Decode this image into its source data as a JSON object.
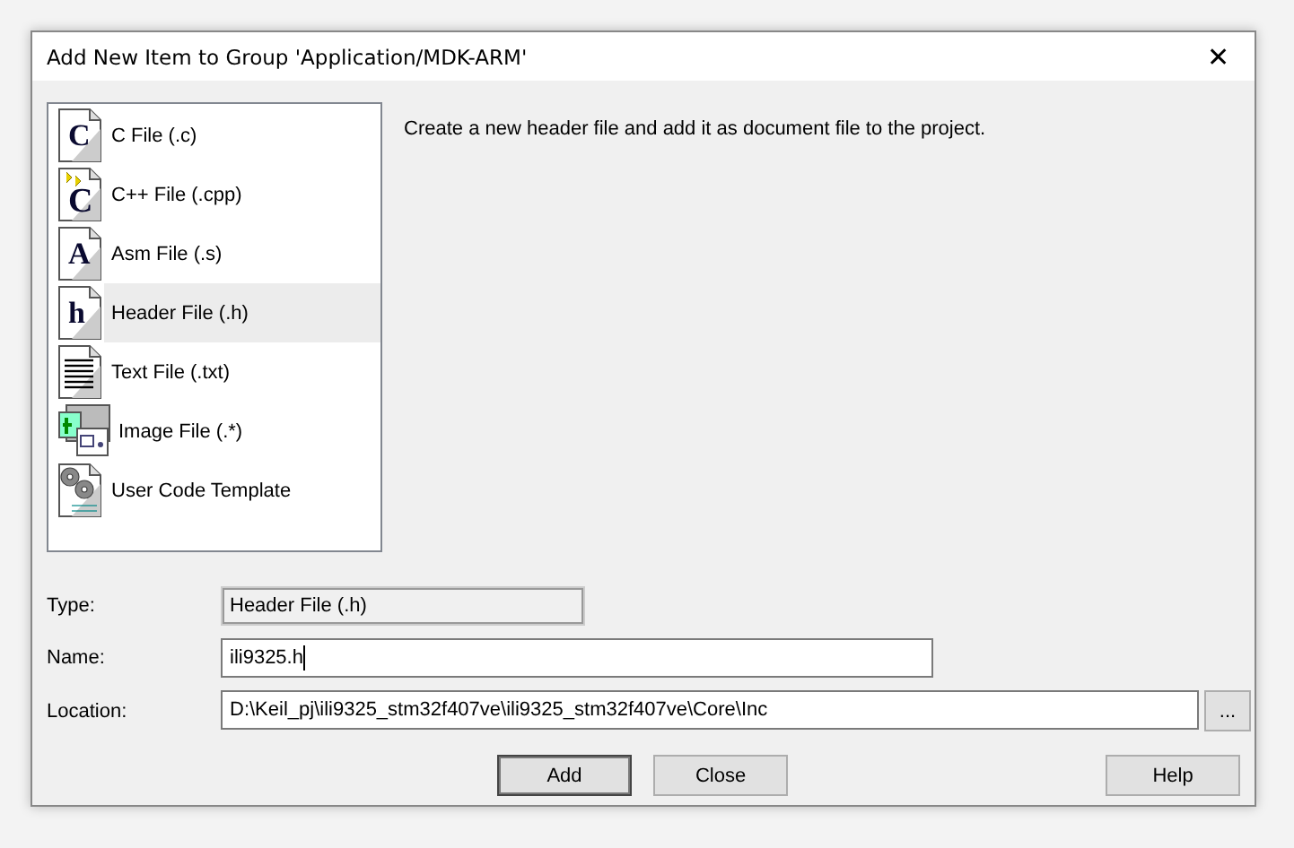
{
  "window": {
    "title": "Add New Item to Group 'Application/MDK-ARM'",
    "close": "✕"
  },
  "file_types": [
    {
      "label": "C File (.c)",
      "kind": "letter",
      "glyph": "C",
      "selected": false
    },
    {
      "label": "C++ File (.cpp)",
      "kind": "cpp",
      "glyph": "C",
      "selected": false
    },
    {
      "label": "Asm File (.s)",
      "kind": "letter",
      "glyph": "A",
      "selected": false
    },
    {
      "label": "Header File (.h)",
      "kind": "letter",
      "glyph": "h",
      "selected": true
    },
    {
      "label": "Text File (.txt)",
      "kind": "text",
      "selected": false
    },
    {
      "label": "Image File (.*)",
      "kind": "image",
      "selected": false
    },
    {
      "label": "User Code Template",
      "kind": "template",
      "selected": false
    }
  ],
  "description": "Create a new header file and add it as document file to the project.",
  "form": {
    "type": {
      "label": "Type:",
      "value": "Header File (.h)"
    },
    "name": {
      "label": "Name:",
      "value": "ili9325.h"
    },
    "location": {
      "label": "Location:",
      "value": "D:\\Keil_pj\\ili9325_stm32f407ve\\ili9325_stm32f407ve\\Core\\Inc",
      "browse": "..."
    }
  },
  "buttons": [
    {
      "label": "Add",
      "default": true
    },
    {
      "label": "Close",
      "default": false
    },
    {
      "label": "Help",
      "default": false
    }
  ]
}
